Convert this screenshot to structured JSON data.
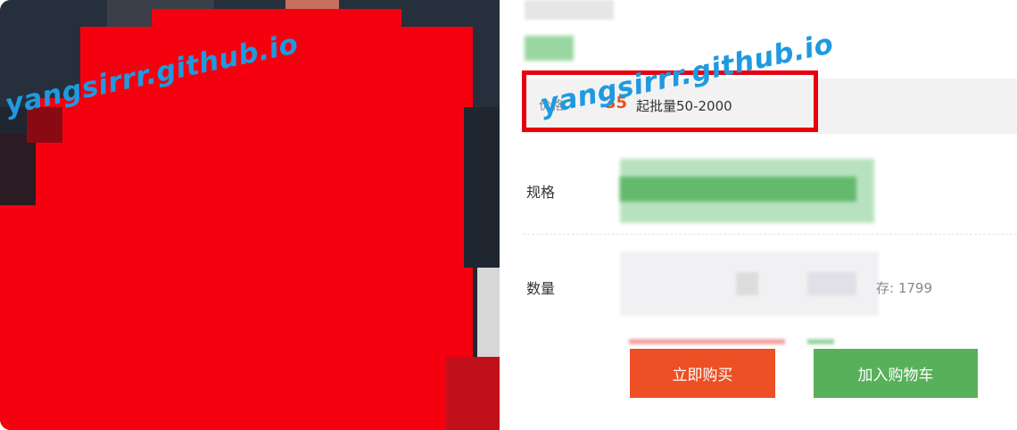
{
  "watermark": {
    "text": "yangsirrr.github.io"
  },
  "product": {
    "price_label": "价格",
    "price_value": "35",
    "moq_text": "起批量50-2000"
  },
  "spec": {
    "label": "规格"
  },
  "quantity": {
    "label": "数量",
    "stock_text": "存: 1799"
  },
  "actions": {
    "buy_now": "立即购买",
    "add_to_cart": "加入购物车"
  },
  "colors": {
    "highlight_box": "#e8000f",
    "buy_now": "#ec5024",
    "add_to_cart": "#59b05a",
    "price": "#e8541e",
    "watermark": "#1e9ae0"
  }
}
